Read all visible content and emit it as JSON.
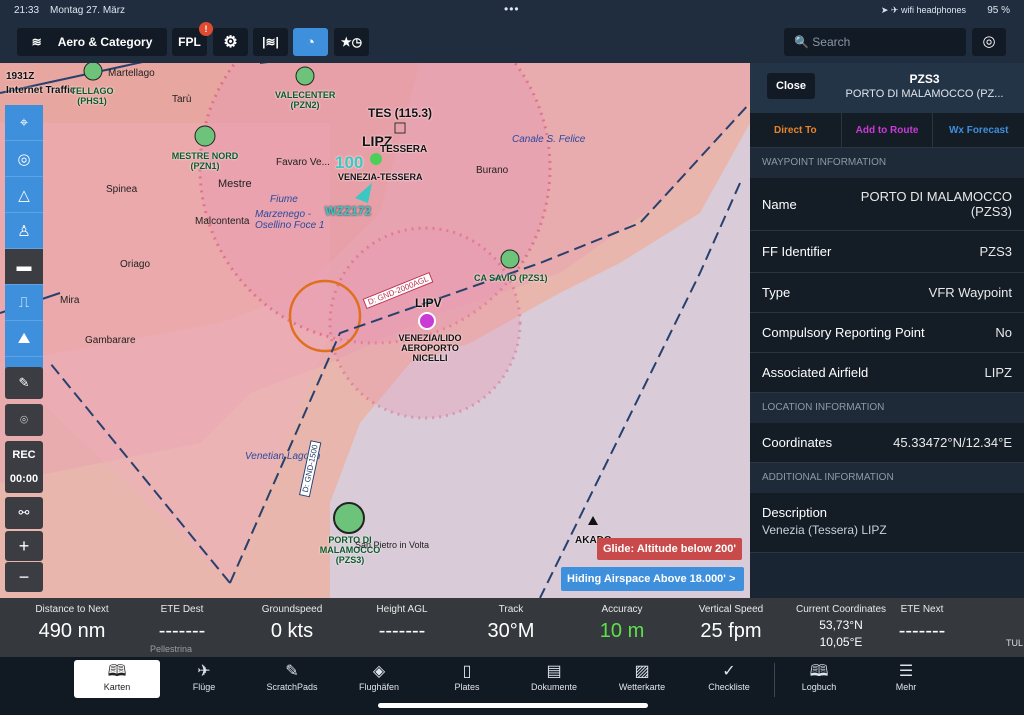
{
  "status": {
    "time": "21:33",
    "date": "Montag 27. März",
    "battery": "95 %",
    "icons": "➤ ✈ wifi headphones"
  },
  "toolbar": {
    "layers_label": "Aero & Category",
    "fpl_label": "FPL",
    "fpl_badge": "!",
    "search_placeholder": "Search"
  },
  "map": {
    "time_z": "1931Z",
    "traffic": "Internet Traffic",
    "labels": [
      "Martellago",
      "TELLAGO (PHS1)",
      "Tarù",
      "VALECENTER (PZN2)",
      "TES (115.3)",
      "LIPZ",
      "TESSERA",
      "Canale S. Felice",
      "MESTRE NORD (PZN1)",
      "100",
      "VENEZIA-TESSERA",
      "Favaro Ve...",
      "Spinea",
      "Mestre",
      "Burano",
      "Fiume",
      "Marzenego - Osellino Foce 1",
      "WZZ172",
      "Malcontenta",
      "Oriago",
      "CA SAVIO (PZS1)",
      "Mira",
      "D: GND-2000AGL",
      "LIPV",
      "VENEZIA/LIDO AEROPORTO NICELLI",
      "Gambarare",
      "Venetian Lagoon",
      "D: GND-1500",
      "PORTO DI MALAMOCCO (PZS3)",
      "San Pietro in Volta",
      "AKADO",
      "Pellestrina",
      "TUL"
    ],
    "glide_warning": "Glide: Altitude below 200'",
    "airspace_button": "Hiding Airspace Above 18.000' >"
  },
  "left_controls": {
    "rec": "REC",
    "timer": "00:00"
  },
  "infobar": [
    {
      "label": "Distance to Next",
      "value": "490 nm"
    },
    {
      "label": "ETE Dest",
      "value": "-------"
    },
    {
      "label": "Groundspeed",
      "value": "0 kts"
    },
    {
      "label": "Height AGL",
      "value": "-------"
    },
    {
      "label": "Track",
      "value": "30°M"
    },
    {
      "label": "Accuracy",
      "value": "10 m"
    },
    {
      "label": "Vertical Speed",
      "value": "25 fpm"
    },
    {
      "label": "Current Coordinates",
      "value": "53,73°N",
      "value2": "10,05°E"
    },
    {
      "label": "ETE Next",
      "value": "-------"
    }
  ],
  "tabs": [
    "Karten",
    "Flüge",
    "ScratchPads",
    "Flughäfen",
    "Plates",
    "Dokumente",
    "Wetterkarte",
    "Checkliste",
    "Logbuch",
    "Mehr"
  ],
  "panel": {
    "close": "Close",
    "title": "PZS3",
    "subtitle": "PORTO DI MALAMOCCO (PZ...",
    "actions": [
      "Direct To",
      "Add to Route",
      "Wx Forecast"
    ],
    "sections": {
      "waypoint": "WAYPOINT INFORMATION",
      "location": "LOCATION INFORMATION",
      "additional": "ADDITIONAL INFORMATION"
    },
    "rows": [
      {
        "k": "Name",
        "v": "PORTO DI MALAMOCCO (PZS3)"
      },
      {
        "k": "FF Identifier",
        "v": "PZS3"
      },
      {
        "k": "Type",
        "v": "VFR Waypoint"
      },
      {
        "k": "Compulsory Reporting Point",
        "v": "No"
      },
      {
        "k": "Associated Airfield",
        "v": "LIPZ"
      },
      {
        "k": "Coordinates",
        "v": "45.33472°N/12.34°E"
      }
    ],
    "description_label": "Description",
    "description": "Venezia (Tessera) LIPZ"
  },
  "colors": {
    "accent": "#3e8fdc",
    "direct_to": "#e8832a",
    "add_route": "#c93ad6",
    "wx": "#3e8fdc",
    "accuracy": "#5ee04a",
    "warning": "#c94a4a"
  }
}
